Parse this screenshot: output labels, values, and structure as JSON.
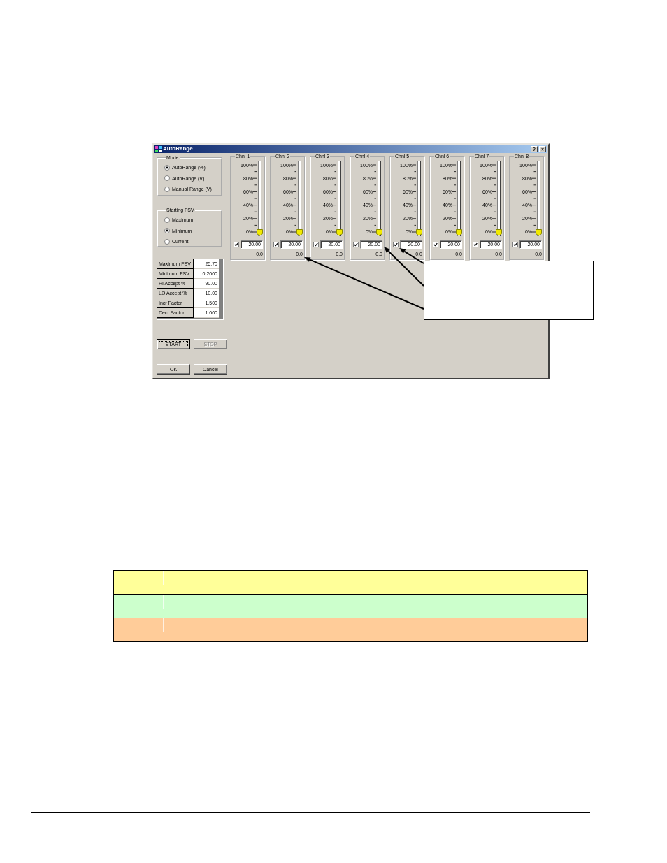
{
  "dialog": {
    "title": "AutoRange",
    "help_button": "?",
    "close_button": "×",
    "mode": {
      "label": "Mode",
      "options": [
        {
          "label": "AutoRange (%)",
          "selected": true
        },
        {
          "label": "AutoRange (V)",
          "selected": false
        },
        {
          "label": "Manual Range (V)",
          "selected": false
        }
      ]
    },
    "starting_fsv": {
      "label": "Starting FSV",
      "options": [
        {
          "label": "Maximum",
          "selected": false
        },
        {
          "label": "Minimum",
          "selected": true
        },
        {
          "label": "Current",
          "selected": false
        }
      ]
    },
    "parameters": [
      {
        "label": "Maximum FSV",
        "value": "25.70"
      },
      {
        "label": "Minimum FSV",
        "value": "0.2000"
      },
      {
        "label": "HI Accept %",
        "value": "90.00"
      },
      {
        "label": "LO Accept %",
        "value": "10.00"
      },
      {
        "label": "Incr Factor",
        "value": "1.500"
      },
      {
        "label": "Decr Factor",
        "value": "1.000"
      }
    ],
    "run_buttons": [
      {
        "label": "START",
        "focused": true,
        "disabled": false
      },
      {
        "label": "STOP",
        "focused": false,
        "disabled": true
      }
    ],
    "dialog_buttons": [
      {
        "label": "OK",
        "focused": false,
        "disabled": false
      },
      {
        "label": "Cancel",
        "focused": false,
        "disabled": false
      }
    ],
    "channels": [
      {
        "name": "Chnl 1",
        "scale": [
          "100%",
          "80%",
          "60%",
          "40%",
          "20%",
          "0%"
        ],
        "level": 0,
        "checked": true,
        "value": "20.00",
        "reading": "0.0"
      },
      {
        "name": "Chnl 2",
        "scale": [
          "100%",
          "80%",
          "60%",
          "40%",
          "20%",
          "0%"
        ],
        "level": 0,
        "checked": true,
        "value": "20.00",
        "reading": "0.0"
      },
      {
        "name": "Chnl 3",
        "scale": [
          "100%",
          "80%",
          "60%",
          "40%",
          "20%",
          "0%"
        ],
        "level": 0,
        "checked": true,
        "value": "20.00",
        "reading": "0.0"
      },
      {
        "name": "Chnl 4",
        "scale": [
          "100%",
          "80%",
          "60%",
          "40%",
          "20%",
          "0%"
        ],
        "level": 0,
        "checked": true,
        "value": "20.00",
        "reading": "0.0"
      },
      {
        "name": "Chnl 5",
        "scale": [
          "100%",
          "80%",
          "60%",
          "40%",
          "20%",
          "0%"
        ],
        "level": 0,
        "checked": true,
        "value": "20.00",
        "reading": "0.0"
      },
      {
        "name": "Chnl 6",
        "scale": [
          "100%",
          "80%",
          "60%",
          "40%",
          "20%",
          "0%"
        ],
        "level": 0,
        "checked": true,
        "value": "20.00",
        "reading": "0.0"
      },
      {
        "name": "Chnl 7",
        "scale": [
          "100%",
          "80%",
          "60%",
          "40%",
          "20%",
          "0%"
        ],
        "level": 0,
        "checked": true,
        "value": "20.00",
        "reading": "0.0"
      },
      {
        "name": "Chnl 8",
        "scale": [
          "100%",
          "80%",
          "60%",
          "40%",
          "20%",
          "0%"
        ],
        "level": 0,
        "checked": true,
        "value": "20.00",
        "reading": "0.0"
      }
    ]
  },
  "color_table": {
    "rows": [
      {
        "color": "#ffff99"
      },
      {
        "color": "#ccffcc"
      },
      {
        "color": "#ffcc99"
      }
    ]
  }
}
